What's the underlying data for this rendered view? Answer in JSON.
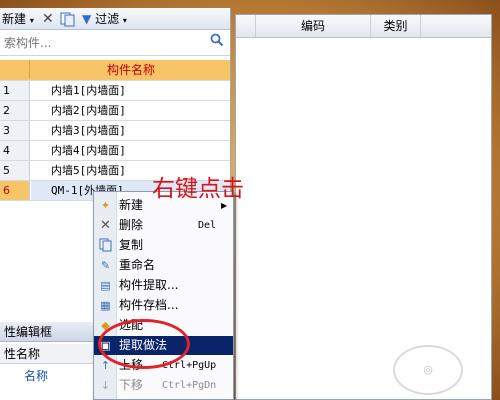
{
  "toolbar": {
    "new_label": "新建",
    "filter_label": "过滤"
  },
  "search": {
    "placeholder": "索构件..."
  },
  "grid": {
    "header": "构件名称",
    "rows": [
      {
        "num": "1",
        "name": "内墙1[内墙面]"
      },
      {
        "num": "2",
        "name": "内墙2[内墙面]"
      },
      {
        "num": "3",
        "name": "内墙3[内墙面]"
      },
      {
        "num": "4",
        "name": "内墙4[内墙面]"
      },
      {
        "num": "5",
        "name": "内墙5[内墙面]"
      },
      {
        "num": "6",
        "name": "QM-1[外墙面]"
      }
    ]
  },
  "props": {
    "title": "性编辑框",
    "column": "性名称",
    "row": "名称"
  },
  "right_panel": {
    "col_code": "编码",
    "col_type": "类别"
  },
  "context_menu": {
    "items": [
      {
        "label": "新建",
        "shortcut": ""
      },
      {
        "label": "删除",
        "shortcut": "Del"
      },
      {
        "label": "复制",
        "shortcut": ""
      },
      {
        "label": "重命名",
        "shortcut": ""
      },
      {
        "label": "构件提取...",
        "shortcut": ""
      },
      {
        "label": "构件存档...",
        "shortcut": ""
      },
      {
        "label": "选配",
        "shortcut": ""
      },
      {
        "label": "提取做法",
        "shortcut": ""
      },
      {
        "label": "上移",
        "shortcut": "Ctrl+PgUp"
      },
      {
        "label": "下移",
        "shortcut": "Ctrl+PgDn"
      }
    ]
  },
  "annotation": "右键点击",
  "colors": {
    "header_bg": "#f7c468",
    "menu_active": "#0a246a",
    "annotation_red": "#d7141a"
  }
}
